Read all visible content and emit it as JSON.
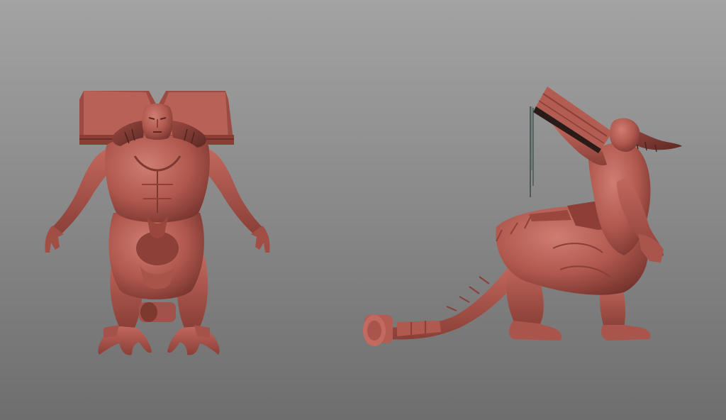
{
  "scene": {
    "background_top": "#a3a3a3",
    "background_bottom": "#6e6e6e",
    "clay_color": "#b55f55",
    "clay_highlight": "#d4837a",
    "clay_shadow": "#6e2f2a",
    "book_spine": "#2a1a18"
  },
  "models": [
    {
      "name": "demon-front-view",
      "view": "front"
    },
    {
      "name": "demon-side-view",
      "view": "side"
    }
  ]
}
